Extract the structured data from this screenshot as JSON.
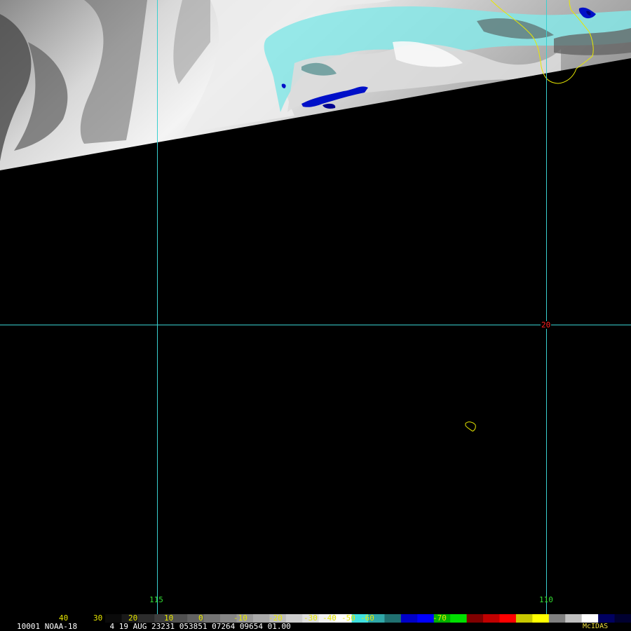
{
  "satellite_image": {
    "grid_labels": {
      "lon_115": "115",
      "lon_110": "110",
      "lat_20": "20"
    },
    "colors": {
      "grid": "#39d0d0",
      "coastline": "#e8e800",
      "lat_label": "#ff2020",
      "lon_label": "#33dd33",
      "background": "#000000"
    }
  },
  "colorbar": {
    "tick_labels": [
      "40",
      "30",
      "20",
      "10",
      "0",
      "-10",
      "-20",
      "-30",
      "-40",
      "-50",
      "-60",
      "-70"
    ],
    "segments": [
      "#0a0a0a",
      "#1a1a1a",
      "#2c2c2c",
      "#3e3e3e",
      "#505050",
      "#626262",
      "#747474",
      "#868686",
      "#989898",
      "#aaaaaa",
      "#bcbcbc",
      "#cecece",
      "#e0e0e0",
      "#f2f2f2",
      "#ffffff",
      "#40e0e0",
      "#30a8a8",
      "#207070",
      "#0000c8",
      "#0000ff",
      "#00b000",
      "#00e000",
      "#800000",
      "#c00000",
      "#ff0000",
      "#c8c800",
      "#ffff00",
      "#808080",
      "#c0c0c0",
      "#ffffff",
      "#000060",
      "#000030"
    ]
  },
  "footer": {
    "info_line": "10001 NOAA-18       4 19 AUG 23231 053851 07264 09654 01.00",
    "brand": "McIDAS"
  }
}
